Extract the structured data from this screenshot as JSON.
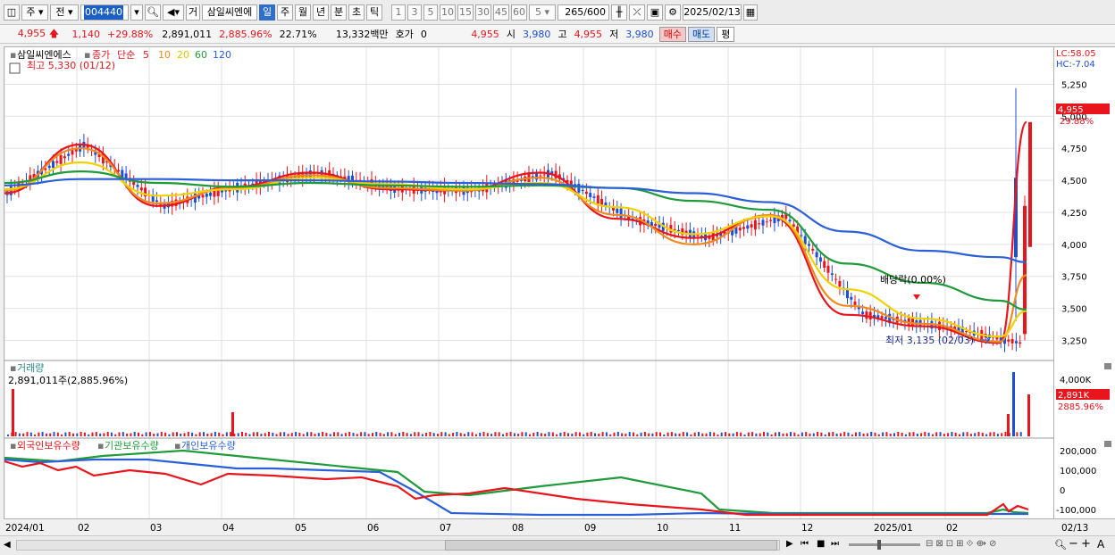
{
  "toolbar": {
    "period_select": "주",
    "prev_label": "전",
    "stock_code": "004440",
    "geo_label": "거",
    "stock_name": "삼일씨엔에",
    "timeframes": [
      "일",
      "주",
      "월",
      "년",
      "분",
      "초",
      "틱"
    ],
    "active_timeframe": "일",
    "minute_options": [
      "1",
      "3",
      "5",
      "10",
      "15",
      "30",
      "45",
      "60"
    ],
    "selected_minute": "5",
    "count": "265",
    "total": "/600",
    "date": "2025/02/13"
  },
  "info": {
    "price": "4,955",
    "change": "1,140",
    "change_pct": "+29.88%",
    "volume": "2,891,011",
    "volume_pct": "2,885.96%",
    "turnover_pct": "22.71%",
    "amount": "13,332백만",
    "quote_label": "호가",
    "quote_value": "0",
    "quote_price": "4,955",
    "open_label": "시",
    "open": "3,980",
    "high_label": "고",
    "high": "4,955",
    "low_label": "저",
    "low": "3,980",
    "buy": "매수",
    "sell": "매도",
    "eval": "평"
  },
  "price_panel": {
    "title": "삼일씨엔에스",
    "close_label": "종가",
    "ma_label": "단순",
    "ma_periods": [
      "5",
      "10",
      "20",
      "60",
      "120"
    ],
    "ma_colors": [
      "#e8151d",
      "#f08a1e",
      "#f0d200",
      "#1f9b3a",
      "#2b60d8"
    ],
    "max_label": "최고 5,330 (01/12)",
    "min_label": "최저 3,135 (02/03)",
    "dividend_label": "배당락(0.00%)",
    "lc": "LC:58.05",
    "hc": "HC:-7.04",
    "last_price": "4,955",
    "last_pct": "29.88%"
  },
  "volume_panel": {
    "title": "거래량",
    "value": "2,891,011주(2,885.96%)",
    "axis_max": "4,000K",
    "last": "2,891K",
    "last_pct": "2885.96%"
  },
  "holdings_panel": {
    "series": [
      "외국인보유수량",
      "기관보유수량",
      "개인보유수량"
    ],
    "axis": [
      "200,000",
      "100,000",
      "0",
      "-100,000"
    ]
  },
  "x_axis": [
    "2024/01",
    "02",
    "03",
    "04",
    "05",
    "06",
    "07",
    "08",
    "09",
    "10",
    "11",
    "12",
    "2025/01",
    "02",
    "02/13"
  ],
  "chart_data": {
    "type": "line",
    "price_axis": [
      "5,250",
      "5,000",
      "4,750",
      "4,500",
      "4,250",
      "4,000",
      "3,750",
      "3,500",
      "3,250"
    ],
    "ylim": [
      3100,
      5330
    ],
    "months": [
      "2024/01",
      "02",
      "03",
      "04",
      "05",
      "06",
      "07",
      "08",
      "09",
      "10",
      "11",
      "12",
      "2025/01",
      "02"
    ],
    "series": [
      {
        "name": "5",
        "values": [
          4400,
          4780,
          4300,
          4450,
          4560,
          4430,
          4420,
          4560,
          4200,
          4050,
          4220,
          3450,
          3360,
          3230,
          4955
        ]
      },
      {
        "name": "10",
        "values": [
          4420,
          4750,
          4320,
          4440,
          4540,
          4440,
          4420,
          4520,
          4230,
          4000,
          4230,
          3520,
          3380,
          3240,
          3760
        ]
      },
      {
        "name": "20",
        "values": [
          4430,
          4640,
          4380,
          4430,
          4520,
          4470,
          4430,
          4480,
          4290,
          4080,
          4220,
          3650,
          3420,
          3280,
          3480
        ]
      },
      {
        "name": "60",
        "values": [
          4480,
          4570,
          4480,
          4450,
          4480,
          4460,
          4450,
          4460,
          4440,
          4340,
          4270,
          3850,
          3700,
          3560,
          3490
        ]
      },
      {
        "name": "120",
        "values": [
          4460,
          4510,
          4510,
          4500,
          4500,
          4490,
          4480,
          4470,
          4440,
          4400,
          4330,
          4100,
          3950,
          3900,
          3860
        ]
      }
    ]
  }
}
